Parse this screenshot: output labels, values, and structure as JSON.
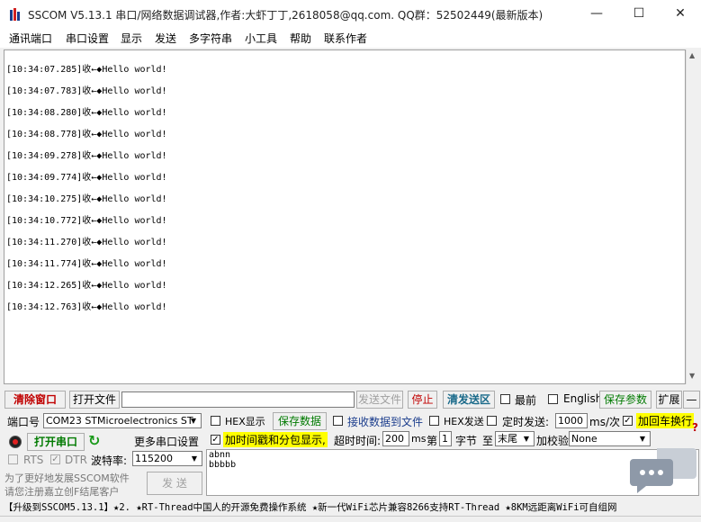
{
  "window": {
    "title": "SSCOM V5.13.1 串口/网络数据调试器,作者:大虾丁丁,2618058@qq.com. QQ群：52502449(最新版本)",
    "minimize": "—",
    "maximize": "☐",
    "close": "✕"
  },
  "menu": [
    "通讯端口",
    "串口设置",
    "显示",
    "发送",
    "多字符串",
    "小工具",
    "帮助",
    "联系作者"
  ],
  "receive_lines": [
    "[10:34:07.285]收←◆Hello world!",
    "[10:34:07.783]收←◆Hello world!",
    "[10:34:08.280]收←◆Hello world!",
    "[10:34:08.778]收←◆Hello world!",
    "[10:34:09.278]收←◆Hello world!",
    "[10:34:09.774]收←◆Hello world!",
    "[10:34:10.275]收←◆Hello world!",
    "[10:34:10.772]收←◆Hello world!",
    "[10:34:11.270]收←◆Hello world!",
    "[10:34:11.774]收←◆Hello world!",
    "[10:34:12.265]收←◆Hello world!",
    "[10:34:12.763]收←◆Hello world!"
  ],
  "toolbar1": {
    "clear_window": "清除窗口",
    "open_file": "打开文件",
    "file_path": "",
    "send_file": "发送文件",
    "stop": "停止",
    "clear_send": "清发送区",
    "topmost": "最前",
    "english": "English",
    "save_params": "保存参数",
    "expand": "扩展",
    "collapse": "—"
  },
  "port": {
    "label": "端口号",
    "value": "COM23 STMicroelectronics ST",
    "open_button": "打开串口",
    "more_settings": "更多串口设置",
    "rts": "RTS",
    "dtr": "DTR",
    "baud_label": "波特率:",
    "baud_value": "115200"
  },
  "options": {
    "hex_display": "HEX显示",
    "save_data": "保存数据",
    "recv_to_file": "接收数据到文件",
    "hex_send": "HEX发送",
    "timed_send": "定时发送:",
    "interval": "1000",
    "interval_unit": "ms/次",
    "add_crlf": "加回车换行",
    "timestamp": "加时间戳和分包显示,",
    "timeout_label": "超时时间:",
    "timeout_value": "200",
    "timeout_unit": "ms",
    "byte_prefix": "第",
    "byte_value": "1",
    "byte_label": "字节",
    "to_label": "至",
    "tail_value": "末尾",
    "checksum_label": "加校验",
    "checksum_value": "None"
  },
  "send_text": [
    "abnn",
    "bbbbb"
  ],
  "send_button": "发  送",
  "promo": [
    "为了更好地发展SSCOM软件",
    "请您注册嘉立创F结尾客户"
  ],
  "ticker": "【升级到SSCOM5.13.1】★2. ★RT-Thread中国人的开源免费操作系统 ★新一代WiFi芯片兼容8266支持RT-Thread ★8KM远距离WiFi可自组网",
  "help_mark": "?",
  "colors": {
    "accent_red": "#c00000",
    "accent_green": "#007a00",
    "highlight": "#ffff00"
  }
}
